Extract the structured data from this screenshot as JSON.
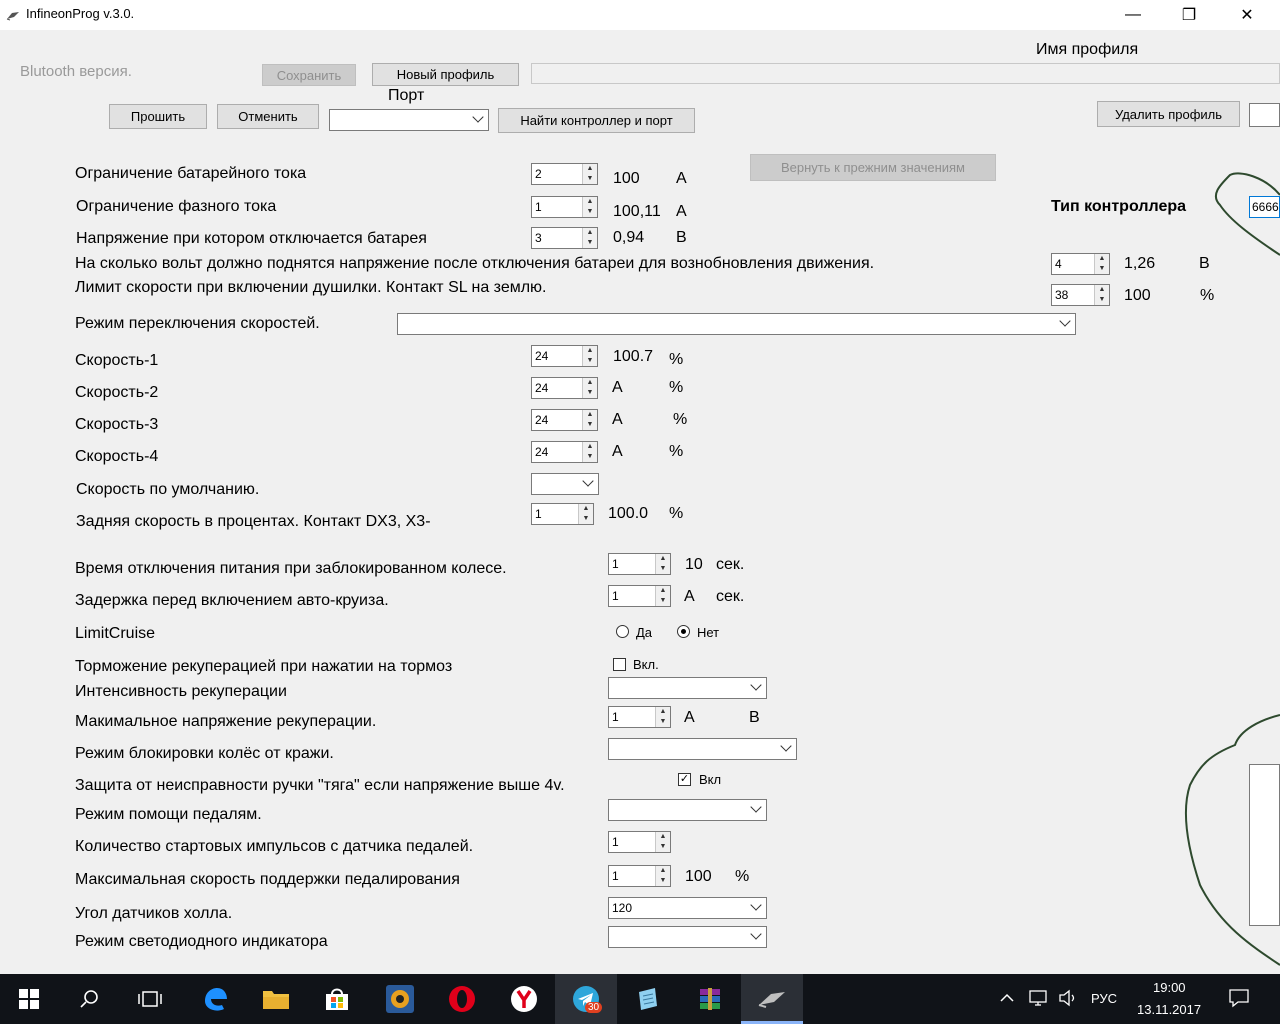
{
  "window": {
    "title": "InfineonProg v.3.0.",
    "minimize": "—",
    "maximize": "❐",
    "close": "✕"
  },
  "header": {
    "bluetooth_label": "Blutooth версия.",
    "save_button": "Сохранить",
    "new_profile_button": "Новый профиль",
    "profile_name_label": "Имя профиля",
    "profile_name_value": "",
    "port_label": "Порт",
    "flash_button": "Прошить",
    "cancel_button": "Отменить",
    "port_value": "",
    "find_controller_button": "Найти контроллер и порт",
    "delete_profile_button": "Удалить профиль",
    "restore_button": "Вернуть к прежним значениям",
    "controller_type_label": "Тип контроллера",
    "controller_type_value": "6666"
  },
  "rows": {
    "battery_current": {
      "label": "Ограничение батарейного тока",
      "value": "2",
      "readout": "100",
      "unit": "А"
    },
    "phase_current": {
      "label": "Ограничение фазного тока",
      "value": "1",
      "readout": "100,11",
      "unit": "А"
    },
    "cutoff_voltage": {
      "label": "Напряжение при котором отключается батарея",
      "value": "3",
      "readout": "0,94",
      "unit": "В"
    },
    "resume_voltage": {
      "label": "На сколько вольт должно поднятся напряжение после отключения батареи для вознобновления движения.",
      "value": "4",
      "readout": "1,26",
      "unit": "В"
    },
    "throttle_limit": {
      "label": "Лимит скорости при включении душилки. Контакт SL на землю.",
      "value": "38",
      "readout": "100",
      "unit": "%"
    },
    "speed_mode": {
      "label": "Режим переключения скоростей.",
      "value": ""
    },
    "speed1": {
      "label": "Скорость-1",
      "value": "24",
      "readout": "100.7",
      "unit": "%"
    },
    "speed2": {
      "label": "Скорость-2",
      "value": "24",
      "readout": "А",
      "unit": "%"
    },
    "speed3": {
      "label": "Скорость-3",
      "value": "24",
      "readout": "А",
      "unit": "%"
    },
    "speed4": {
      "label": "Скорость-4",
      "value": "24",
      "readout": "А",
      "unit": "%"
    },
    "default_speed": {
      "label": "Скорость по умолчанию.",
      "value": ""
    },
    "reverse_speed": {
      "label": "Задняя скорость в процентах. Контакт DX3, X3-",
      "value": "1",
      "readout": "100.0",
      "unit": "%"
    },
    "block_time": {
      "label": "Время отключения питания при заблокированном колесе.",
      "value": "1",
      "readout": "10",
      "unit": "сек."
    },
    "cruise_delay": {
      "label": "Задержка перед включением авто-круиза.",
      "value": "1",
      "readout": "А",
      "unit": "сек."
    },
    "limit_cruise": {
      "label": "LimitCruise",
      "option_yes": "Да",
      "option_no": "Нет",
      "selected": "Нет"
    },
    "regen_brake": {
      "label": "Торможение рекуперацией при нажатии на тормоз",
      "checkbox_label": "Вкл.",
      "checked": false
    },
    "regen_intensity": {
      "label": "Интенсивность рекуперации",
      "value": ""
    },
    "regen_max_voltage": {
      "label": "Макимальное напряжение рекуперации.",
      "value": "1",
      "readout": "А",
      "unit": "В"
    },
    "anti_theft": {
      "label": "Режим блокировки колёс от кражи.",
      "value": ""
    },
    "throttle_protect": {
      "label": "Защита от неисправности ручки \"тяга\" если напряжение выше 4v.",
      "checkbox_label": "Вкл",
      "checked": true
    },
    "pas_mode": {
      "label": "Режим помощи педалям.",
      "value": ""
    },
    "pas_pulses": {
      "label": "Количество стартовых импульсов с датчика педалей.",
      "value": "1"
    },
    "pas_max_speed": {
      "label": "Максимальная скорость поддержки педалирования",
      "value": "1",
      "readout": "100",
      "unit": "%"
    },
    "hall_angle": {
      "label": "Угол датчиков холла.",
      "value": "120"
    },
    "led_mode": {
      "label": "Режим светодиодного индикатора",
      "value": ""
    }
  },
  "taskbar": {
    "telegram_badge": "30",
    "language": "РУС",
    "time": "19:00",
    "date": "13.11.2017"
  },
  "colors": {
    "taskbar": "#101318",
    "window_bg": "#f0f0f0",
    "doodle": "#2e4a2e"
  }
}
